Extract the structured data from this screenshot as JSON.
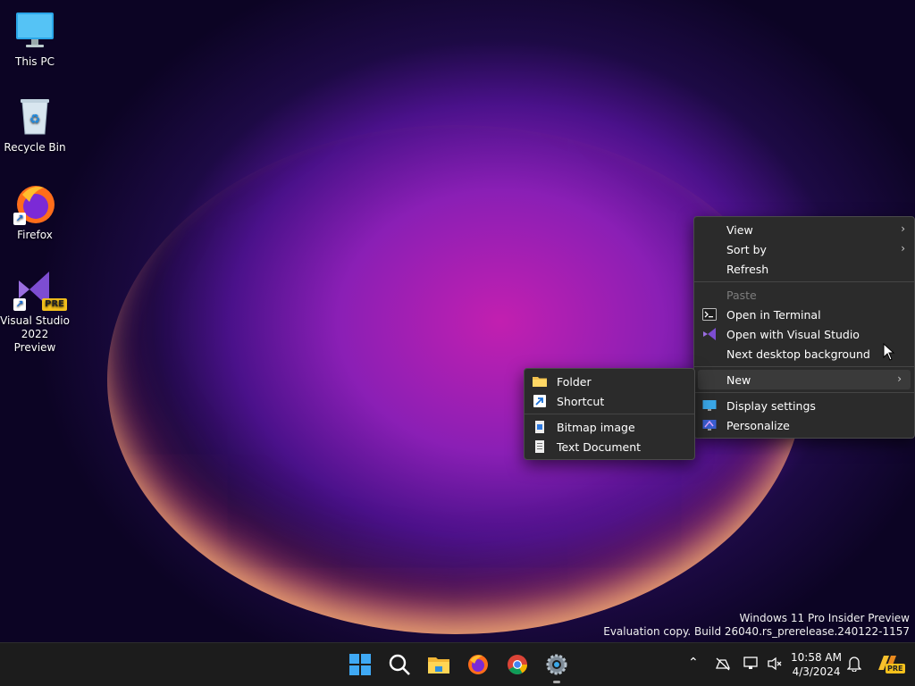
{
  "desktop": {
    "icons": [
      {
        "label": "This PC"
      },
      {
        "label": "Recycle Bin"
      },
      {
        "label": "Firefox"
      },
      {
        "label": "Visual Studio 2022 Preview",
        "badge": "PRE"
      }
    ]
  },
  "context_menu": {
    "items": [
      {
        "label": "View",
        "submenu": true
      },
      {
        "label": "Sort by",
        "submenu": true
      },
      {
        "label": "Refresh"
      },
      {
        "label": "Paste",
        "disabled": true
      },
      {
        "label": "Open in Terminal",
        "icon": "terminal-icon"
      },
      {
        "label": "Open with Visual Studio",
        "icon": "visual-studio-icon"
      },
      {
        "label": "Next desktop background"
      },
      {
        "label": "New",
        "submenu": true,
        "active": true
      },
      {
        "label": "Display settings",
        "icon": "display-icon"
      },
      {
        "label": "Personalize",
        "icon": "personalize-icon"
      }
    ]
  },
  "new_submenu": {
    "items": [
      {
        "label": "Folder",
        "icon": "folder-icon"
      },
      {
        "label": "Shortcut",
        "icon": "shortcut-icon"
      },
      {
        "label": "Bitmap image",
        "icon": "bitmap-icon"
      },
      {
        "label": "Text Document",
        "icon": "text-document-icon"
      }
    ]
  },
  "watermark": {
    "line1": "Windows 11 Pro Insider Preview",
    "line2": "Evaluation copy. Build 26040.rs_prerelease.240122-1157"
  },
  "taskbar": {
    "apps": [
      "start-icon",
      "search-icon",
      "file-explorer-icon",
      "firefox-icon",
      "chrome-icon",
      "settings-icon"
    ],
    "clock": {
      "time": "10:58 AM",
      "date": "4/3/2024"
    },
    "tray_badge": "PRE"
  },
  "colors": {
    "accent": "#0078d4",
    "menu_bg": "#2b2b2b"
  }
}
